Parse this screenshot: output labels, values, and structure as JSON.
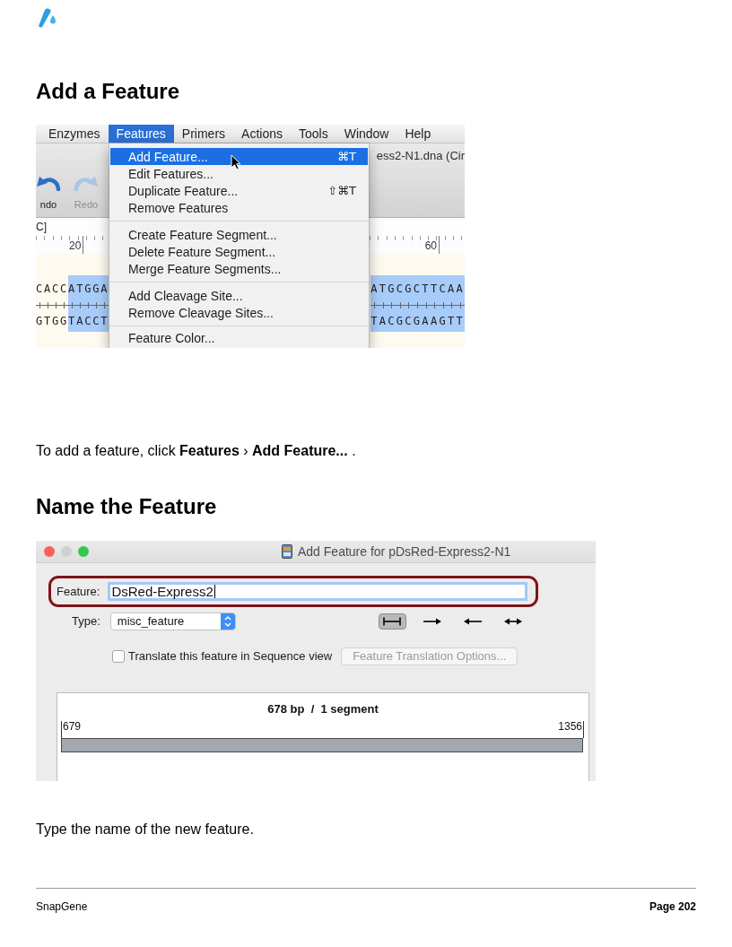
{
  "sections": [
    {
      "heading": "Add a Feature",
      "screenshot": {
        "kind": "menu",
        "menubar": [
          {
            "label": "Enzymes",
            "selected": false
          },
          {
            "label": "Features",
            "selected": true
          },
          {
            "label": "Primers",
            "selected": false
          },
          {
            "label": "Actions",
            "selected": false
          },
          {
            "label": "Tools",
            "selected": false
          },
          {
            "label": "Window",
            "selected": false
          },
          {
            "label": "Help",
            "selected": false
          }
        ],
        "toolbar": [
          {
            "kind": "undo",
            "label": "ndo",
            "disabled": false
          },
          {
            "kind": "redo",
            "label": "Redo",
            "disabled": true
          }
        ],
        "window_title": "ess2-N1.dna (Cir",
        "sequence_name": "C]",
        "ruler": [
          "20",
          "60"
        ],
        "sequence": {
          "left": [
            {
              "top": "CACC",
              "bottom": "GTGG",
              "selected": false
            },
            {
              "top": "ATGGA",
              "bottom": "TACCT",
              "selected": true
            }
          ],
          "right": [
            {
              "top": "ATGCGCTTCAA",
              "bottom": "TACGCGAAGTT",
              "selected": true
            }
          ]
        },
        "menu": [
          [
            {
              "label": "Add Feature...",
              "shortcut": "⌘T",
              "selected": true
            },
            {
              "label": "Edit Features...",
              "selected": false
            },
            {
              "label": "Duplicate Feature...",
              "shortcut": "⇧⌘T",
              "selected": false
            },
            {
              "label": "Remove Features",
              "selected": false
            }
          ],
          [
            {
              "label": "Create Feature Segment...",
              "selected": false
            },
            {
              "label": "Delete Feature Segment...",
              "selected": false
            },
            {
              "label": "Merge Feature Segments...",
              "selected": false
            }
          ],
          [
            {
              "label": "Add Cleavage Site...",
              "selected": false
            },
            {
              "label": "Remove Cleavage Sites...",
              "selected": false
            }
          ],
          [
            {
              "label": "Feature Color...",
              "selected": false
            }
          ]
        ]
      },
      "caption": "To add a feature, click **Features** › **Add Feature...** ."
    },
    {
      "heading": "Name the Feature",
      "screenshot": {
        "kind": "dialog",
        "title": "Add Feature for pDsRed-Express2-N1",
        "feature": {
          "label": "Feature:",
          "value": "DsRed-Express2",
          "focused": true,
          "highlighted": true
        },
        "type": {
          "label": "Type:",
          "value": "misc_feature"
        },
        "directions": [
          {
            "kind": "none",
            "selected": true
          },
          {
            "kind": "forward",
            "selected": false
          },
          {
            "kind": "reverse",
            "selected": false
          },
          {
            "kind": "both",
            "selected": false
          }
        ],
        "translate": {
          "label": "Translate this feature in Sequence view",
          "checked": false
        },
        "options_button": {
          "label": "Feature Translation Options...",
          "disabled": true
        },
        "map": {
          "summary": "678 bp  /  1 segment",
          "start": "679",
          "end": "1356"
        }
      },
      "caption": "Type the name of the new feature."
    }
  ],
  "footer": {
    "left": "SnapGene",
    "right": "Page 202"
  }
}
